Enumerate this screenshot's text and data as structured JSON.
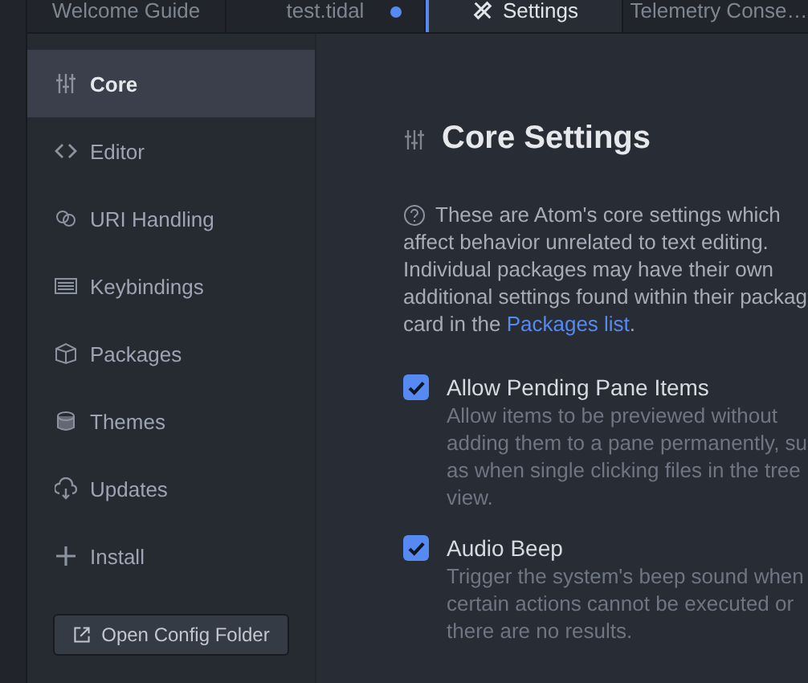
{
  "tabs": [
    {
      "label": "Welcome Guide",
      "selected": false,
      "modified": false
    },
    {
      "label": "test.tidal",
      "selected": false,
      "modified": true
    },
    {
      "label": "Settings",
      "selected": true,
      "modified": false
    },
    {
      "label": "Telemetry Conse…",
      "selected": false,
      "modified": false
    }
  ],
  "sidebar": {
    "items": [
      {
        "label": "Core",
        "selected": true
      },
      {
        "label": "Editor",
        "selected": false
      },
      {
        "label": "URI Handling",
        "selected": false
      },
      {
        "label": "Keybindings",
        "selected": false
      },
      {
        "label": "Packages",
        "selected": false
      },
      {
        "label": "Themes",
        "selected": false
      },
      {
        "label": "Updates",
        "selected": false
      },
      {
        "label": "Install",
        "selected": false
      }
    ],
    "button": "Open Config Folder"
  },
  "content": {
    "title": "Core Settings",
    "description_lines": [
      "These are Atom's core settings which",
      "affect behavior unrelated to text editing.",
      "Individual packages may have their own",
      "additional settings found within their packag",
      "card in the "
    ],
    "link": "Packages list",
    "description_end": ".",
    "settings": [
      {
        "title": "Allow Pending Pane Items",
        "checked": true,
        "description_lines": [
          "Allow items to be previewed without",
          "adding them to a pane permanently, su",
          "as when single clicking files in the tree",
          "view."
        ]
      },
      {
        "title": "Audio Beep",
        "checked": true,
        "description_lines": [
          "Trigger the system's beep sound when",
          "certain actions cannot be executed or",
          "there are no results."
        ]
      }
    ]
  }
}
